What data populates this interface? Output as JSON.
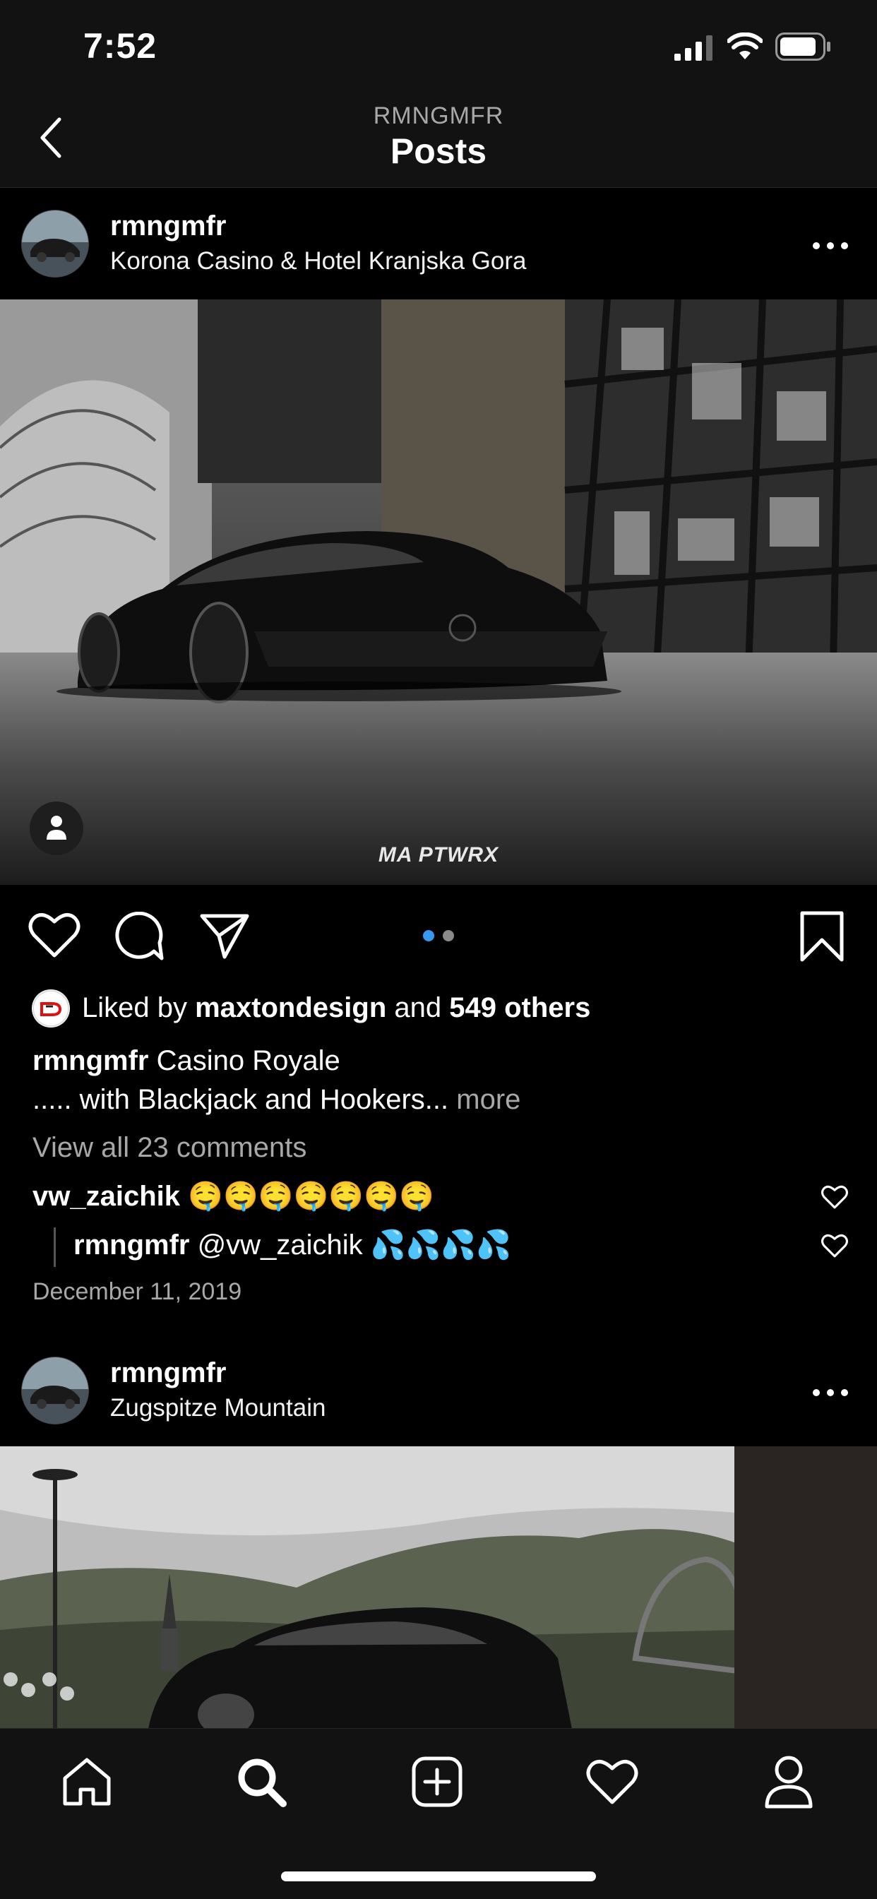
{
  "status_bar": {
    "time": "7:52"
  },
  "header": {
    "account": "RMNGMFR",
    "title": "Posts"
  },
  "posts": [
    {
      "username": "rmngmfr",
      "location": "Korona Casino & Hotel Kranjska Gora",
      "watermark": "MA PTWRX",
      "likes": {
        "prefix": "Liked by",
        "user": "maxtondesign",
        "joiner": "and",
        "others": "549 others"
      },
      "caption": {
        "user": "rmngmfr",
        "line1": "Casino Royale",
        "line2": "..... with Blackjack and Hookers...",
        "more": "more"
      },
      "view_comments": "View all 23 comments",
      "comments": [
        {
          "user": "vw_zaichik",
          "text": "🤤🤤🤤🤤🤤🤤🤤"
        },
        {
          "user": "rmngmfr",
          "text": "@vw_zaichik 💦💦💦💦"
        }
      ],
      "date": "December 11, 2019",
      "carousel": {
        "count": 2,
        "active": 1
      }
    },
    {
      "username": "rmngmfr",
      "location": "Zugspitze Mountain"
    }
  ],
  "icons": {
    "back": "chevron-left-icon",
    "like": "heart-icon",
    "comment": "comment-icon",
    "share": "paper-plane-icon",
    "save": "bookmark-icon",
    "tabs": [
      "home-icon",
      "search-icon",
      "add-post-icon",
      "activity-heart-icon",
      "profile-icon"
    ]
  },
  "colors": {
    "background": "#000000",
    "bar": "#121212",
    "accent": "#3897f0",
    "muted": "#a8a8a8"
  }
}
